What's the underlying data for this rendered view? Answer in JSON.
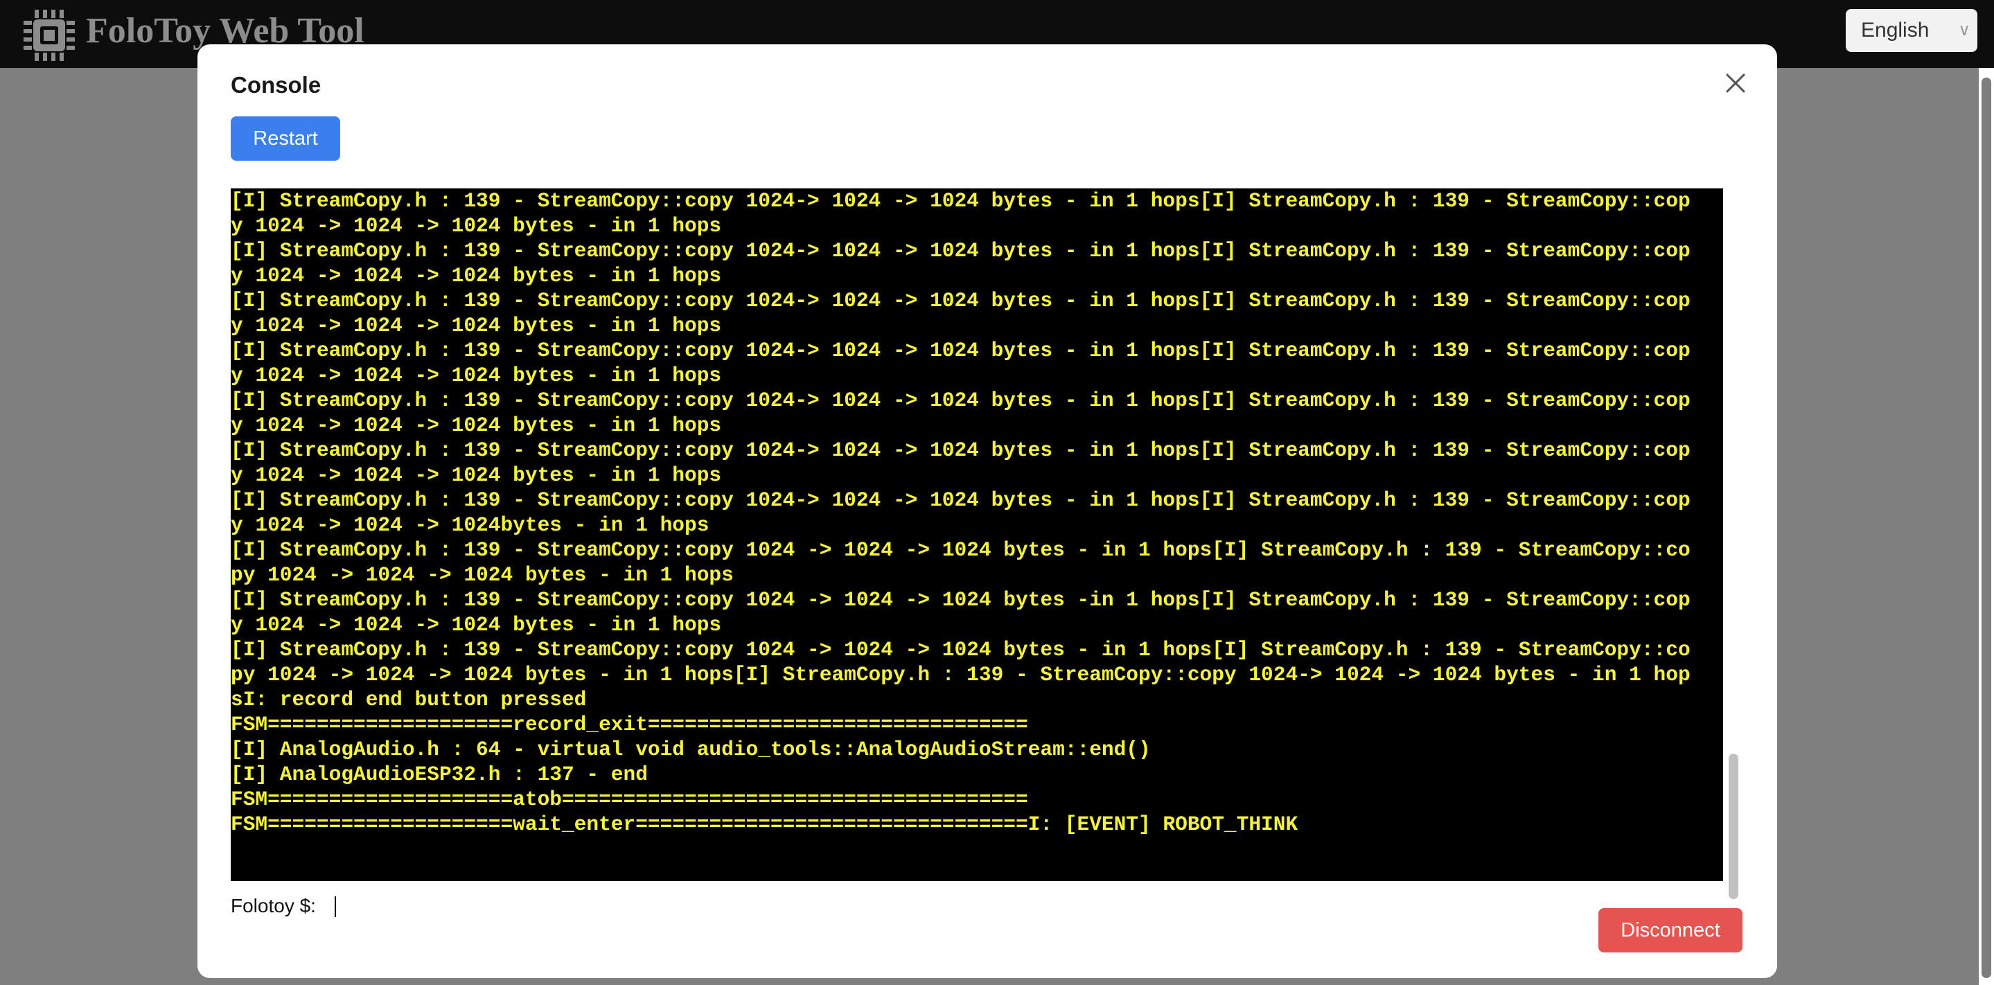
{
  "header": {
    "app_title": "FoloToy Web Tool",
    "logo_icon": "chip-icon",
    "language": "English"
  },
  "modal": {
    "title": "Console",
    "restart_label": "Restart",
    "close_icon": "close-icon",
    "disconnect_label": "Disconnect",
    "prompt_label": "Folotoy $:",
    "prompt_value": ""
  },
  "console_lines": [
    "[I] StreamCopy.h : 139 - StreamCopy::copy 1024-> 1024 -> 1024 bytes - in 1 hops[I] StreamCopy.h : 139 - StreamCopy::cop",
    "y 1024 -> 1024 -> 1024 bytes - in 1 hops",
    "[I] StreamCopy.h : 139 - StreamCopy::copy 1024-> 1024 -> 1024 bytes - in 1 hops[I] StreamCopy.h : 139 - StreamCopy::cop",
    "y 1024 -> 1024 -> 1024 bytes - in 1 hops",
    "[I] StreamCopy.h : 139 - StreamCopy::copy 1024-> 1024 -> 1024 bytes - in 1 hops[I] StreamCopy.h : 139 - StreamCopy::cop",
    "y 1024 -> 1024 -> 1024 bytes - in 1 hops",
    "[I] StreamCopy.h : 139 - StreamCopy::copy 1024-> 1024 -> 1024 bytes - in 1 hops[I] StreamCopy.h : 139 - StreamCopy::cop",
    "y 1024 -> 1024 -> 1024 bytes - in 1 hops",
    "[I] StreamCopy.h : 139 - StreamCopy::copy 1024-> 1024 -> 1024 bytes - in 1 hops[I] StreamCopy.h : 139 - StreamCopy::cop",
    "y 1024 -> 1024 -> 1024 bytes - in 1 hops",
    "[I] StreamCopy.h : 139 - StreamCopy::copy 1024-> 1024 -> 1024 bytes - in 1 hops[I] StreamCopy.h : 139 - StreamCopy::cop",
    "y 1024 -> 1024 -> 1024 bytes - in 1 hops",
    "[I] StreamCopy.h : 139 - StreamCopy::copy 1024-> 1024 -> 1024 bytes - in 1 hops[I] StreamCopy.h : 139 - StreamCopy::cop",
    "y 1024 -> 1024 -> 1024bytes - in 1 hops",
    "[I] StreamCopy.h : 139 - StreamCopy::copy 1024 -> 1024 -> 1024 bytes - in 1 hops[I] StreamCopy.h : 139 - StreamCopy::co",
    "py 1024 -> 1024 -> 1024 bytes - in 1 hops",
    "[I] StreamCopy.h : 139 - StreamCopy::copy 1024 -> 1024 -> 1024 bytes -in 1 hops[I] StreamCopy.h : 139 - StreamCopy::cop",
    "y 1024 -> 1024 -> 1024 bytes - in 1 hops",
    "[I] StreamCopy.h : 139 - StreamCopy::copy 1024 -> 1024 -> 1024 bytes - in 1 hops[I] StreamCopy.h : 139 - StreamCopy::co",
    "py 1024 -> 1024 -> 1024 bytes - in 1 hops[I] StreamCopy.h : 139 - StreamCopy::copy 1024-> 1024 -> 1024 bytes - in 1 hop",
    "sI: record end button pressed",
    "FSM====================record_exit===============================",
    "[I] AnalogAudio.h : 64 - virtual void audio_tools::AnalogAudioStream::end()",
    "[I] AnalogAudioESP32.h : 137 - end",
    "FSM====================atob======================================",
    "FSM====================wait_enter================================I: [EVENT] ROBOT_THINK"
  ],
  "colors": {
    "console_text": "#f4f23c",
    "console_bg": "#000000",
    "restart_bg": "#3b7eee",
    "disconnect_bg": "#e65451"
  }
}
